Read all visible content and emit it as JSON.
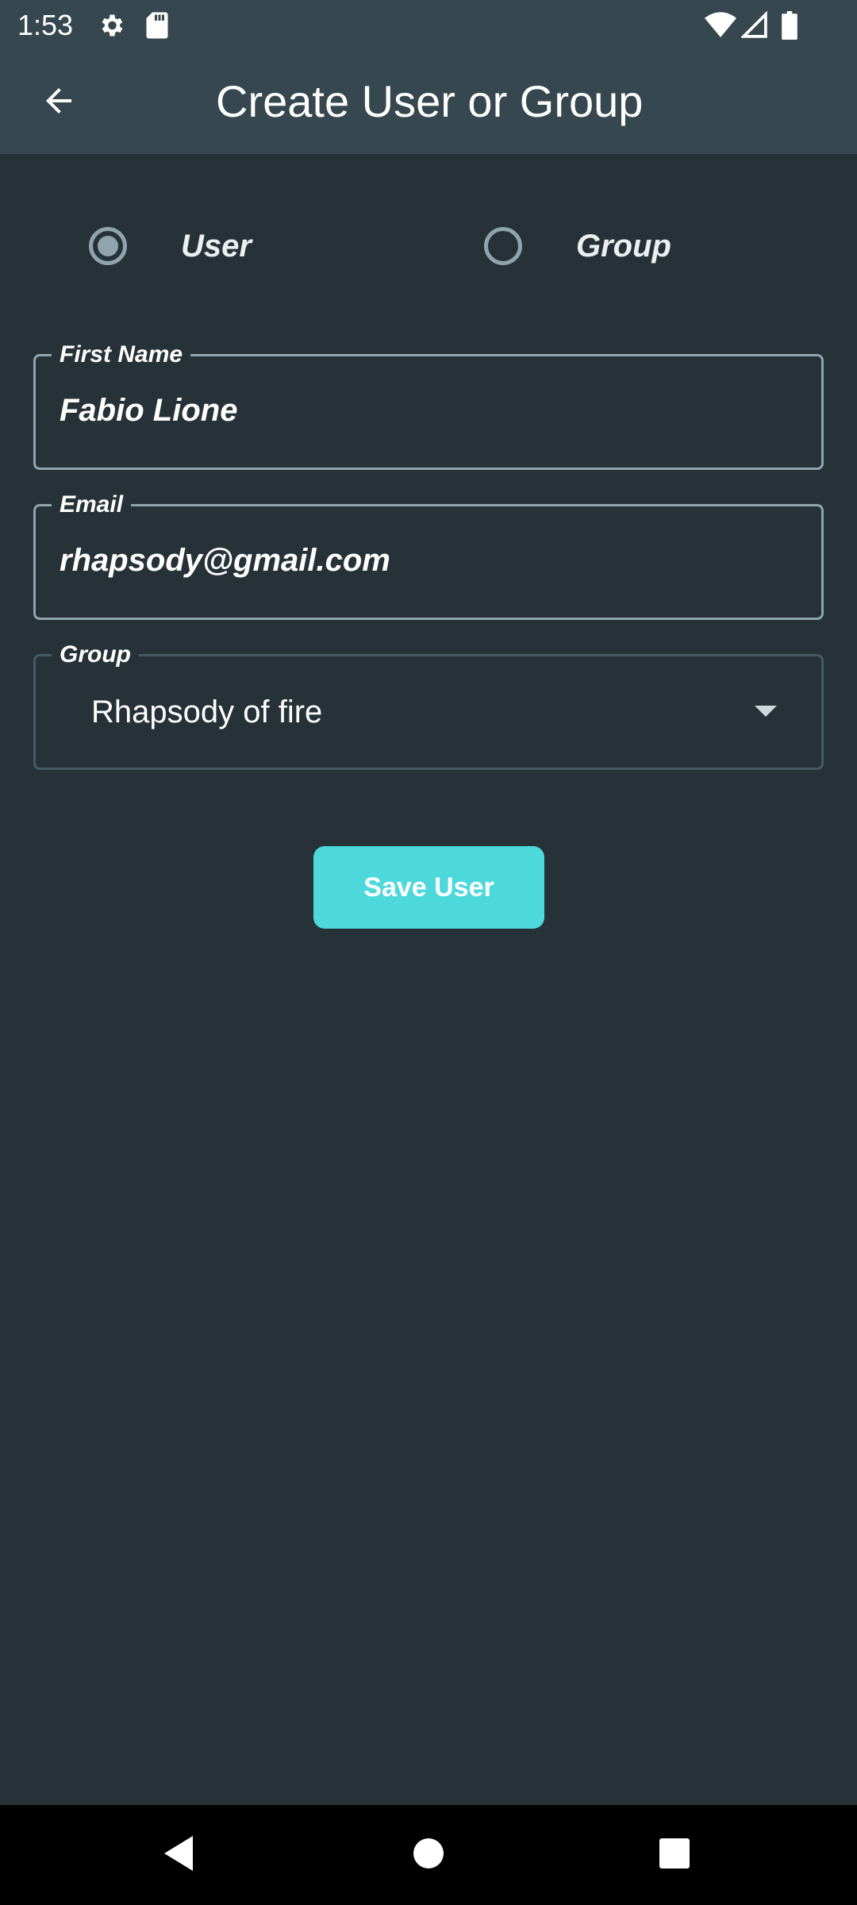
{
  "status_bar": {
    "time": "1:53",
    "icons": [
      "settings-icon",
      "sd-card-icon",
      "wifi-icon",
      "signal-icon",
      "battery-icon"
    ]
  },
  "app_bar": {
    "title": "Create User or Group",
    "back_icon": "arrow-left-icon"
  },
  "type_selector": {
    "options": [
      {
        "label": "User",
        "selected": true
      },
      {
        "label": "Group",
        "selected": false
      }
    ]
  },
  "form": {
    "first_name": {
      "label": "First Name",
      "value": "Fabio Lione"
    },
    "email": {
      "label": "Email",
      "value": "rhapsody@gmail.com"
    },
    "group": {
      "label": "Group",
      "value": "Rhapsody of fire"
    }
  },
  "save_button": {
    "label": "Save User"
  },
  "nav_bar": {
    "buttons": [
      "back-triangle-icon",
      "home-circle-icon",
      "recents-square-icon"
    ]
  },
  "colors": {
    "background": "#263238",
    "app_bar": "#37474f",
    "accent": "#4dd9dc",
    "outline": "#90a4ae"
  }
}
